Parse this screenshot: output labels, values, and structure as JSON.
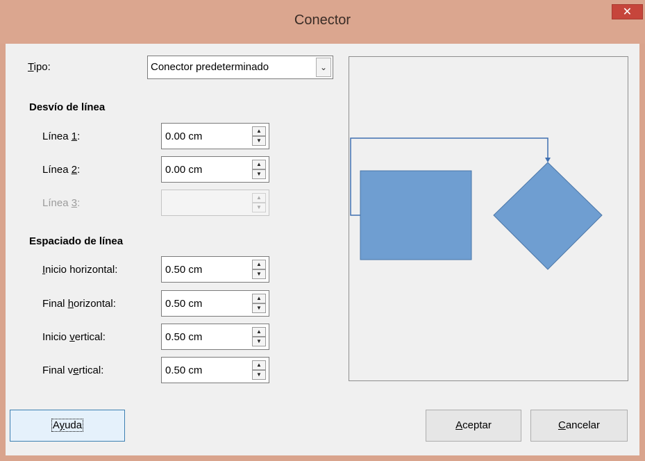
{
  "window": {
    "title": "Conector",
    "close_glyph": "✕"
  },
  "tipo": {
    "label_mnemonic": "T",
    "label_rest": "ipo:",
    "selected": "Conector predeterminado",
    "arrow_glyph": "⌄"
  },
  "desvio": {
    "header": "Desvío de línea",
    "rows": [
      {
        "label_pre": "Línea ",
        "mnemonic": "1",
        "label_post": ":",
        "value": "0.00 cm",
        "enabled": true
      },
      {
        "label_pre": "Línea ",
        "mnemonic": "2",
        "label_post": ":",
        "value": "0.00 cm",
        "enabled": true
      },
      {
        "label_pre": "Línea ",
        "mnemonic": "3",
        "label_post": ":",
        "value": "",
        "enabled": false
      }
    ]
  },
  "espaciado": {
    "header": "Espaciado de línea",
    "rows": [
      {
        "label_pre": "",
        "mnemonic": "I",
        "label_post": "nicio horizontal:",
        "value": "0.50 cm"
      },
      {
        "label_pre": "Final ",
        "mnemonic": "h",
        "label_post": "orizontal:",
        "value": "0.50 cm"
      },
      {
        "label_pre": "Inicio ",
        "mnemonic": "v",
        "label_post": "ertical:",
        "value": "0.50 cm"
      },
      {
        "label_pre": "Final v",
        "mnemonic": "e",
        "label_post": "rtical:",
        "value": "0.50 cm"
      }
    ]
  },
  "spin_glyphs": {
    "up": "▲",
    "down": "▼"
  },
  "preview": {
    "shape_fill": "#6f9ed1",
    "shape_stroke": "#4a76a8",
    "connector_color": "#3f6fb0"
  },
  "buttons": {
    "help": {
      "pre": "A",
      "mnemonic": "y",
      "post": "uda"
    },
    "ok": {
      "pre": "",
      "mnemonic": "A",
      "post": "ceptar"
    },
    "cancel": {
      "pre": "",
      "mnemonic": "C",
      "post": "ancelar"
    }
  }
}
